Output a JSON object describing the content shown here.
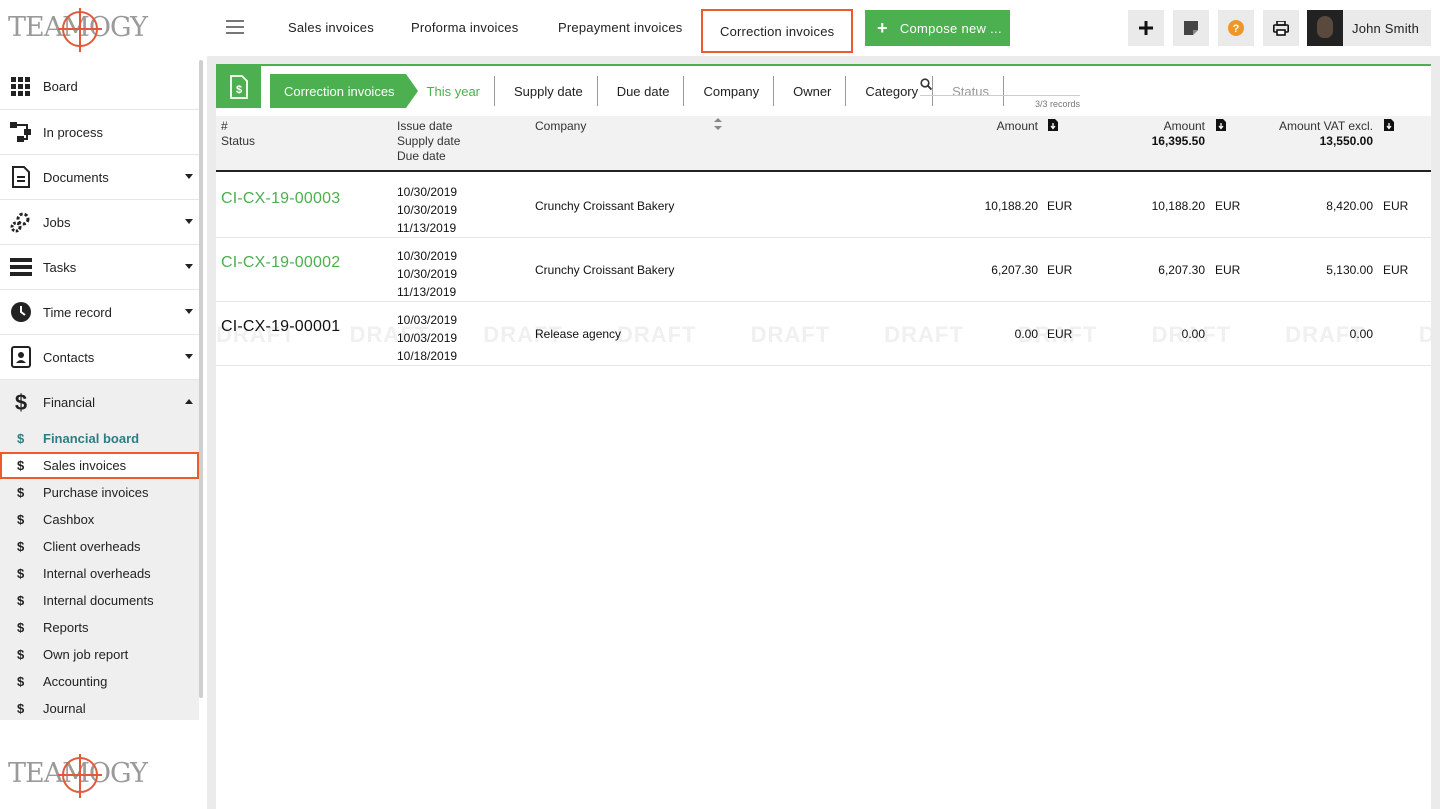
{
  "brand": {
    "logo_text": "TEAMOGY"
  },
  "topbar": {
    "tabs": [
      {
        "label": "Sales invoices"
      },
      {
        "label": "Proforma invoices"
      },
      {
        "label": "Prepayment invoices"
      },
      {
        "label": "Correction invoices"
      }
    ],
    "compose_label": "Compose new ...",
    "user_name": "John Smith"
  },
  "sidebar": {
    "items": [
      {
        "label": "Board"
      },
      {
        "label": "In process"
      },
      {
        "label": "Documents"
      },
      {
        "label": "Jobs"
      },
      {
        "label": "Tasks"
      },
      {
        "label": "Time record"
      },
      {
        "label": "Contacts"
      },
      {
        "label": "Financial"
      }
    ],
    "financial_sub": [
      {
        "label": "Financial board"
      },
      {
        "label": "Sales invoices"
      },
      {
        "label": "Purchase invoices"
      },
      {
        "label": "Cashbox"
      },
      {
        "label": "Client overheads"
      },
      {
        "label": "Internal overheads"
      },
      {
        "label": "Internal documents"
      },
      {
        "label": "Reports"
      },
      {
        "label": "Own job report"
      },
      {
        "label": "Accounting"
      },
      {
        "label": "Journal"
      }
    ]
  },
  "filters": {
    "crumbs": [
      "Correction invoices",
      "This year",
      "Supply date",
      "Due date",
      "Company",
      "Owner",
      "Category",
      "Status"
    ],
    "search_placeholder": "",
    "records": "3/3 records"
  },
  "table": {
    "headers": {
      "num": "#",
      "status": "Status",
      "issue_date": "Issue date",
      "supply_date": "Supply date",
      "due_date": "Due date",
      "company": "Company",
      "amount1": "Amount",
      "amount2": "Amount",
      "amount2_total": "16,395.50",
      "amount3": "Amount VAT excl.",
      "amount3_total": "13,550.00"
    },
    "rows": [
      {
        "number": "CI-CX-19-00003",
        "issue": "10/30/2019",
        "supply": "10/30/2019",
        "due": "11/13/2019",
        "company": "Crunchy Croissant Bakery",
        "amount": "10,188.20",
        "amount_cur": "EUR",
        "amount2": "10,188.20",
        "amount2_cur": "EUR",
        "vat_excl": "8,420.00",
        "vat_cur": "EUR"
      },
      {
        "number": "CI-CX-19-00002",
        "issue": "10/30/2019",
        "supply": "10/30/2019",
        "due": "11/13/2019",
        "company": "Crunchy Croissant Bakery",
        "amount": "6,207.30",
        "amount_cur": "EUR",
        "amount2": "6,207.30",
        "amount2_cur": "EUR",
        "vat_excl": "5,130.00",
        "vat_cur": "EUR"
      },
      {
        "number": "CI-CX-19-00001",
        "issue": "10/03/2019",
        "supply": "10/03/2019",
        "due": "10/18/2019",
        "company": "Release agency",
        "amount": "0.00",
        "amount_cur": "EUR",
        "amount2": "0.00",
        "vat_excl": "0.00",
        "watermark": "DRAFT DRAFT DRAFT DRAFT DRAFT DRAFT DRAFT DRAFT DRAFT DRAFT DRAFT DRAFT DRAFT"
      }
    ]
  },
  "colors": {
    "accent_green": "#4caf50",
    "highlight_orange": "#ec5b2a",
    "teal": "#2f7d84"
  }
}
